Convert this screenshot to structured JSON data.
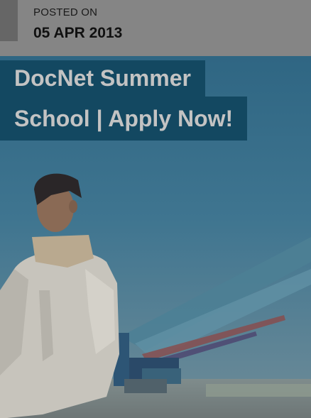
{
  "post": {
    "posted_label": "POSTED ON",
    "date": "05 APR 2013",
    "title_line_1": "DocNet Summer",
    "title_line_2": "School | Apply Now!"
  },
  "colors": {
    "header_bg": "#858585",
    "accent": "#666666",
    "title_bg": "#134861",
    "title_text": "#c3c3c3",
    "sky": "#3a6e8a"
  }
}
